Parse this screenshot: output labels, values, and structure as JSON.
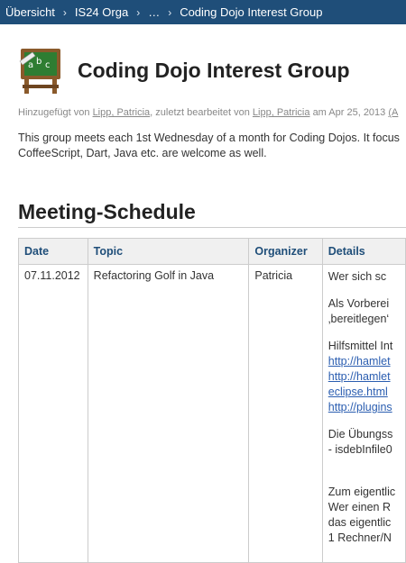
{
  "breadcrumb": [
    "Übersicht",
    "IS24 Orga",
    "…",
    "Coding Dojo Interest Group"
  ],
  "page": {
    "title": "Coding Dojo Interest Group",
    "meta": {
      "added_by_prefix": "Hinzugefügt von",
      "author": "Lipp, Patricia",
      "edited_by_prefix": ", zuletzt bearbeitet von",
      "editor": "Lipp, Patricia",
      "date_prefix": "am Apr 25, 2013",
      "paren": "(A"
    },
    "intro_line1": "This group meets each 1st Wednesday of a month for Coding Dojos. It focus",
    "intro_line2": "CoffeeScript, Dart, Java etc. are welcome as well."
  },
  "schedule": {
    "heading": "Meeting-Schedule",
    "columns": [
      "Date",
      "Topic",
      "Organizer",
      "Details"
    ],
    "rows": [
      {
        "date": "07.11.2012",
        "topic": "Refactoring Golf in Java",
        "organizer": "Patricia",
        "details": {
          "p1": "Wer sich sc",
          "p2a": "Als Vorberei",
          "p2b": "‚bereitlegen‘",
          "p3": "Hilfsmittel Int",
          "link1": "http://hamlet",
          "link2": "http://hamlet",
          "link3": "eclipse.html",
          "link4": "http://plugins",
          "p4a": "Die Übungss",
          "p4b": "- isdebInfile0",
          "p5a": "Zum eigentlic",
          "p5b": "Wer einen R",
          "p5c": "das eigentlic",
          "p5d": "1 Rechner/N"
        }
      }
    ]
  }
}
